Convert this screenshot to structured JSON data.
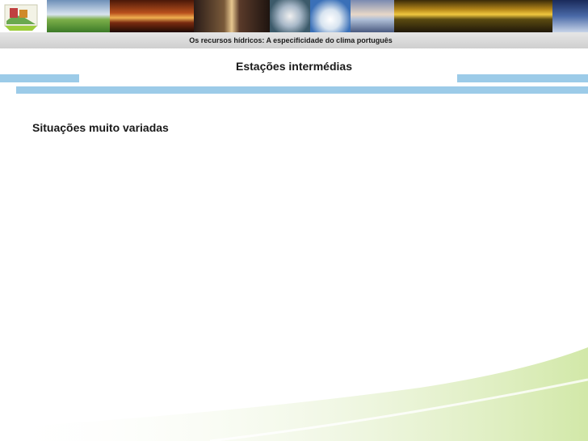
{
  "header": {
    "subtitle": "Os recursos hídricos: A especificidade do clima português",
    "title": "Estações intermédias"
  },
  "content": {
    "heading": "Situações muito variadas"
  },
  "banner": {
    "tiles": [
      "logo",
      "green-hills-photo",
      "sunset-photo",
      "lightning-photo",
      "satellite-photo",
      "clouds-photo",
      "sea-sunset-photo",
      "water-reflection-photo",
      "sky-photo"
    ]
  },
  "colors": {
    "accent_blue": "#8ec2e3",
    "accent_green": "#d9ecb8",
    "strip_grey": "#d9d9d9"
  }
}
